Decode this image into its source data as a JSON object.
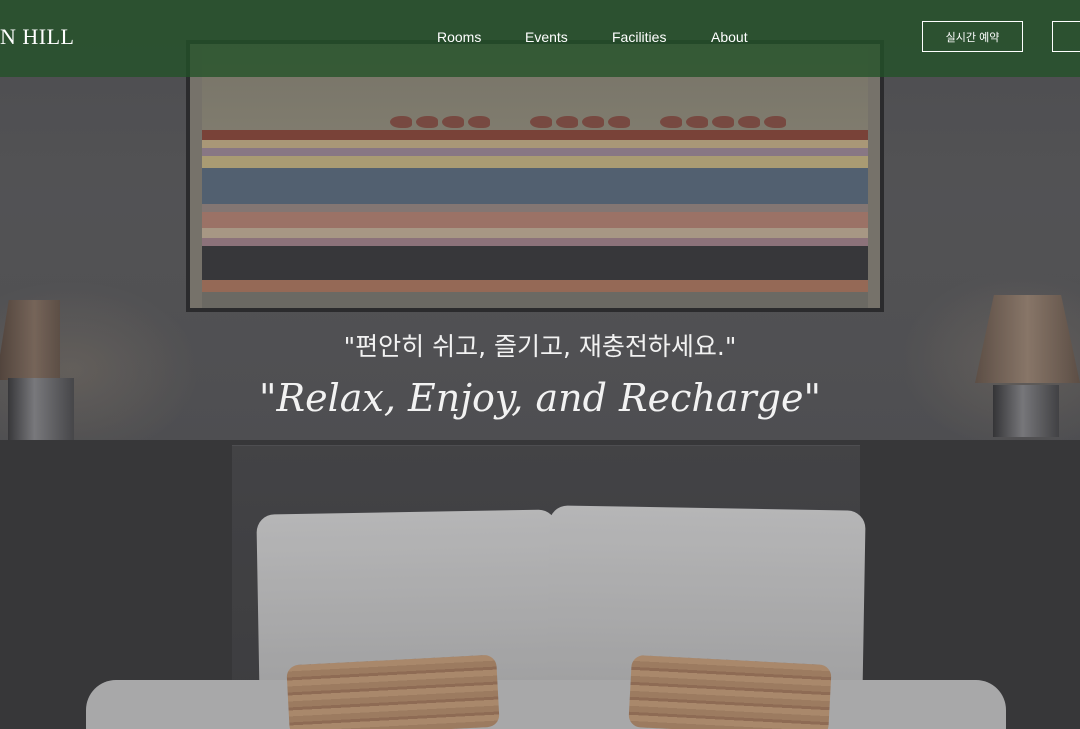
{
  "brand": {
    "logo_text": "N HILL"
  },
  "nav": {
    "links": [
      {
        "label": "Rooms"
      },
      {
        "label": "Events"
      },
      {
        "label": "Facilities"
      },
      {
        "label": "About"
      }
    ],
    "reserve_button": "실시간 예약"
  },
  "hero": {
    "tagline_korean": "\"편안히 쉬고, 즐기고, 재충전하세요.\"",
    "tagline_english": "\"Relax, Enjoy, and Recharge\""
  },
  "colors": {
    "navbar": "#225228",
    "text": "#ffffff"
  }
}
